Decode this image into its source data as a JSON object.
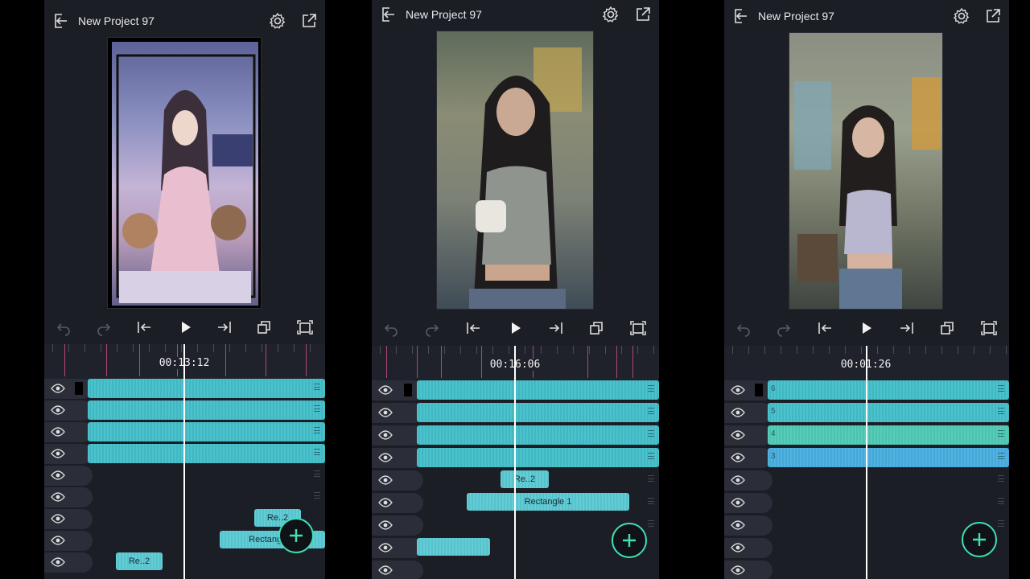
{
  "panels": [
    {
      "project_title": "New Project 97",
      "timecode": "00:13:12",
      "clip_rect": "Rectangle 1",
      "clip_re2": "Re..2",
      "clip_re2b": "Re..2"
    },
    {
      "project_title": "New Project 97",
      "timecode": "00:16:06",
      "clip_rect": "Rectangle 1",
      "clip_re2": "Re..2"
    },
    {
      "project_title": "New Project 97",
      "timecode": "00:01:26",
      "track_numbers": [
        "6",
        "5",
        "4",
        "3"
      ]
    }
  ],
  "icons": {
    "exit": "exit-icon",
    "settings": "gear-icon",
    "export": "export-icon",
    "undo": "undo-icon",
    "redo": "redo-icon",
    "skip_start": "skip-start-icon",
    "play": "play-icon",
    "skip_end": "skip-end-icon",
    "keyframe": "keyframe-icon",
    "fullscreen": "fullscreen-icon",
    "visibility": "eye-icon",
    "add": "plus-icon"
  },
  "colors": {
    "accent": "#3ee0b6",
    "clip": "#4ac3cd",
    "marker": "#c9507c",
    "bg": "#1c1e26"
  }
}
